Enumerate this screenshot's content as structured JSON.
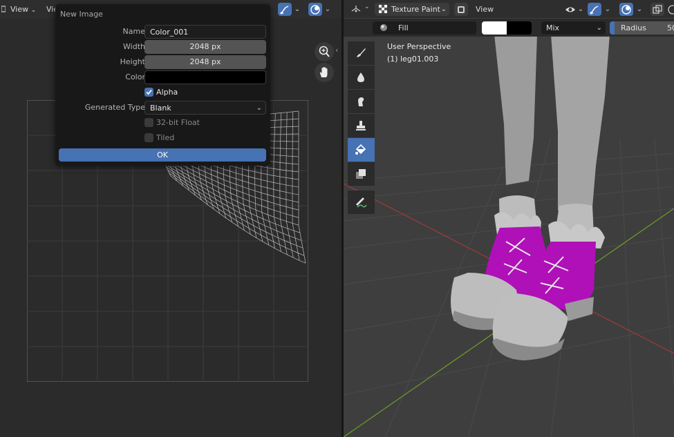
{
  "uv_editor": {
    "header": {
      "view_label": "View",
      "view2_label": "Vie"
    }
  },
  "new_image_dialog": {
    "title": "New Image",
    "name_label": "Name",
    "name_value": "Color_001",
    "width_label": "Width",
    "width_value": "2048 px",
    "height_label": "Height",
    "height_value": "2048 px",
    "color_label": "Color",
    "color_value": "#000000",
    "alpha_label": "Alpha",
    "alpha_checked": true,
    "generated_type_label": "Generated Type",
    "generated_type_value": "Blank",
    "float_label": "32-bit Float",
    "float_checked": false,
    "tiled_label": "Tiled",
    "tiled_checked": false,
    "ok_label": "OK"
  },
  "viewport": {
    "header": {
      "mode_label": "Texture Paint",
      "view_label": "View"
    },
    "tool_header": {
      "brush_name": "Fill",
      "color_primary": "#ffffff",
      "color_secondary": "#000000",
      "blend_mode": "Mix",
      "radius_label": "Radius",
      "radius_value": "50"
    },
    "overlay": {
      "perspective": "User Perspective",
      "object": "(1) leg01.003"
    }
  },
  "colors": {
    "accent": "#4772b3",
    "boot_magenta": "#b010b8",
    "model_gray": "#9c9c9c",
    "x_axis": "#9a3a3a",
    "y_axis": "#6b9a2a"
  }
}
